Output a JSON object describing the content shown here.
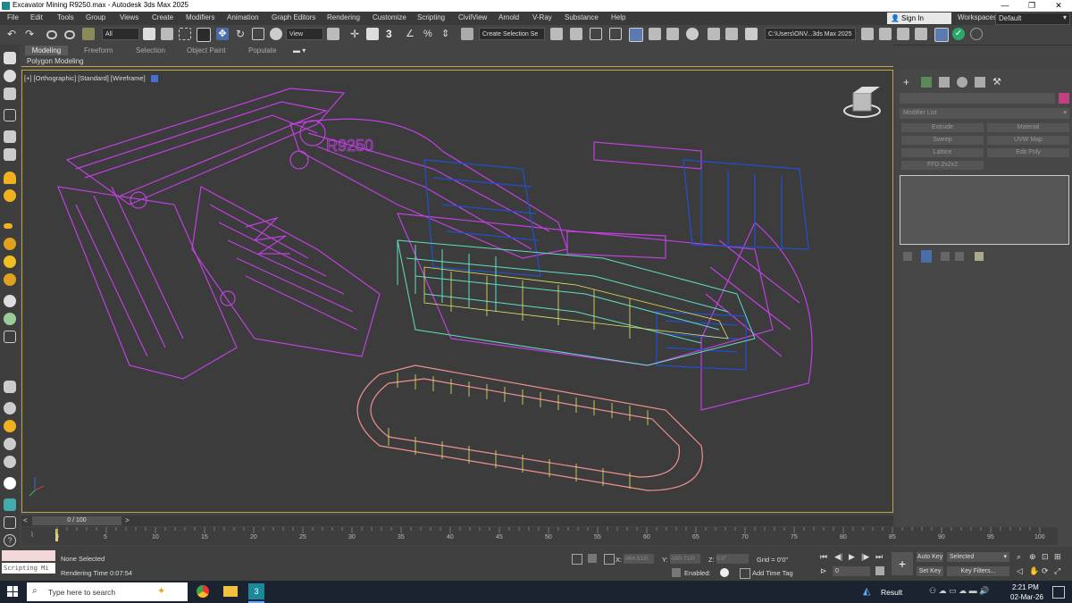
{
  "window": {
    "title": "Excavator Mining R9250.max - Autodesk 3ds Max 2025",
    "minimize": "—",
    "maximize": "❐",
    "close": "✕"
  },
  "menu": [
    "File",
    "Edit",
    "Tools",
    "Group",
    "Views",
    "Create",
    "Modifiers",
    "Animation",
    "Graph Editors",
    "Rendering",
    "Customize",
    "Scripting",
    "CivilView",
    "Arnold",
    "V-Ray",
    "Substance",
    "Help"
  ],
  "signin": {
    "label": "Sign In"
  },
  "workspaces": {
    "label": "Workspaces:",
    "value": "Default"
  },
  "toolbar": {
    "filter_select": "All",
    "refcoord_select": "View",
    "selection_set": "Create Selection Se",
    "project_path": "C:\\Users\\ONV...3ds Max 2025",
    "snap_label": "3",
    "percent_icon": "%"
  },
  "ribbon": {
    "tabs": [
      "Modeling",
      "Freeform",
      "Selection",
      "Object Paint",
      "Populate"
    ],
    "active_tab": "Modeling",
    "panel_label": "Polygon Modeling"
  },
  "viewport": {
    "label": "[+] [Orthographic] [Standard] [Wireframe]",
    "model_text": "R9250",
    "colors": {
      "magenta": "#c040e0",
      "blue": "#2050d0",
      "cyan": "#60e0c0",
      "yellow": "#e8e860",
      "orange": "#f09090",
      "border": "#b8a848"
    }
  },
  "command_panel": {
    "modifier_list": "Modifier List",
    "buttons": [
      "Extrude",
      "Material",
      "Sweep",
      "UVW Map",
      "Lattice",
      "Edit Poly",
      "FFD 2x2x2"
    ]
  },
  "timeline": {
    "frame_counter": "0 / 100",
    "ticks": [
      "0",
      "5",
      "10",
      "15",
      "20",
      "25",
      "30",
      "35",
      "40",
      "45",
      "50",
      "55",
      "60",
      "65",
      "70",
      "75",
      "80",
      "85",
      "90",
      "95",
      "100"
    ]
  },
  "status": {
    "maxscript": "Scripting Mi",
    "selection": "None Selected",
    "render_time": "Rendering Time  0:07:54",
    "x_label": "X:",
    "x_value": "-964.51/0",
    "y_label": "Y:",
    "y_value": "-580.71/0",
    "z_label": "Z:",
    "z_value": "0.0\"",
    "grid": "Grid = 0'0\"",
    "enabled": "Enabled:",
    "add_time_tag": "Add Time Tag",
    "auto_key": "Auto Key",
    "set_key": "Set Key",
    "selected": "Selected",
    "key_filters": "Key Filters...",
    "frame_spinner": "0"
  },
  "taskbar": {
    "search": "Type here to search",
    "result": "Result",
    "time": "2:21 PM",
    "date": "02-Mar-26"
  }
}
